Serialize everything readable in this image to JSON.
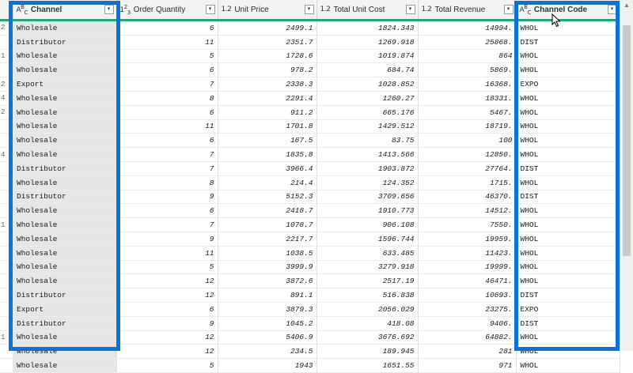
{
  "columns": [
    {
      "key": "channel",
      "type_icon": "A B C",
      "label": "Channel",
      "dropdown_icon": "dropdown-arrow-icon"
    },
    {
      "key": "order_quantity",
      "type_icon": "1 2 3",
      "label": "Order Quantity",
      "dropdown_icon": "dropdown-arrow-icon"
    },
    {
      "key": "unit_price",
      "type_icon": "1.2",
      "label": "Unit Price",
      "dropdown_icon": "dropdown-arrow-icon"
    },
    {
      "key": "total_unit_cost",
      "type_icon": "1.2",
      "label": "Total Unit Cost",
      "dropdown_icon": "dropdown-arrow-icon"
    },
    {
      "key": "total_revenue",
      "type_icon": "1.2",
      "label": "Total Revenue",
      "dropdown_icon": "dropdown-arrow-icon"
    },
    {
      "key": "channel_code",
      "type_icon": "A B C",
      "label": "Channel Code",
      "dropdown_icon": "dropdown-arrow-icon"
    }
  ],
  "rows": [
    {
      "rn": "2",
      "channel": "Wholesale",
      "qty": "6",
      "price": "2499.1",
      "cost": "1824.343",
      "rev": "14994.",
      "code": "WHOL"
    },
    {
      "rn": "",
      "channel": "Distributor",
      "qty": "11",
      "price": "2351.7",
      "cost": "1269.918",
      "rev": "25868.",
      "code": "DIST"
    },
    {
      "rn": "1",
      "channel": "Wholesale",
      "qty": "5",
      "price": "1728.6",
      "cost": "1019.874",
      "rev": "864",
      "code": "WHOL"
    },
    {
      "rn": "",
      "channel": "Wholesale",
      "qty": "6",
      "price": "978.2",
      "cost": "684.74",
      "rev": "5869.",
      "code": "WHOL"
    },
    {
      "rn": "2",
      "channel": "Export",
      "qty": "7",
      "price": "2338.3",
      "cost": "1028.852",
      "rev": "16368.",
      "code": "EXPO"
    },
    {
      "rn": "4",
      "channel": "Wholesale",
      "qty": "8",
      "price": "2291.4",
      "cost": "1260.27",
      "rev": "18331.",
      "code": "WHOL"
    },
    {
      "rn": "2",
      "channel": "Wholesale",
      "qty": "6",
      "price": "911.2",
      "cost": "665.176",
      "rev": "5467.",
      "code": "WHOL"
    },
    {
      "rn": "",
      "channel": "Wholesale",
      "qty": "11",
      "price": "1701.8",
      "cost": "1429.512",
      "rev": "18719.",
      "code": "WHOL"
    },
    {
      "rn": "",
      "channel": "Wholesale",
      "qty": "6",
      "price": "167.5",
      "cost": "83.75",
      "rev": "100",
      "code": "WHOL"
    },
    {
      "rn": "4",
      "channel": "Wholesale",
      "qty": "7",
      "price": "1835.8",
      "cost": "1413.566",
      "rev": "12850.",
      "code": "WHOL"
    },
    {
      "rn": "",
      "channel": "Distributor",
      "qty": "7",
      "price": "3966.4",
      "cost": "1903.872",
      "rev": "27764.",
      "code": "DIST"
    },
    {
      "rn": "",
      "channel": "Wholesale",
      "qty": "8",
      "price": "214.4",
      "cost": "124.352",
      "rev": "1715.",
      "code": "WHOL"
    },
    {
      "rn": "",
      "channel": "Distributor",
      "qty": "9",
      "price": "5152.3",
      "cost": "3709.656",
      "rev": "46370.",
      "code": "DIST"
    },
    {
      "rn": "",
      "channel": "Wholesale",
      "qty": "6",
      "price": "2418.7",
      "cost": "1910.773",
      "rev": "14512.",
      "code": "WHOL"
    },
    {
      "rn": "1",
      "channel": "Wholesale",
      "qty": "7",
      "price": "1078.7",
      "cost": "906.108",
      "rev": "7550.",
      "code": "WHOL"
    },
    {
      "rn": "",
      "channel": "Wholesale",
      "qty": "9",
      "price": "2217.7",
      "cost": "1596.744",
      "rev": "19959.",
      "code": "WHOL"
    },
    {
      "rn": "",
      "channel": "Wholesale",
      "qty": "11",
      "price": "1038.5",
      "cost": "633.485",
      "rev": "11423.",
      "code": "WHOL"
    },
    {
      "rn": "",
      "channel": "Wholesale",
      "qty": "5",
      "price": "3999.9",
      "cost": "3279.918",
      "rev": "19999.",
      "code": "WHOL"
    },
    {
      "rn": "",
      "channel": "Wholesale",
      "qty": "12",
      "price": "3872.6",
      "cost": "2517.19",
      "rev": "46471.",
      "code": "WHOL"
    },
    {
      "rn": "",
      "channel": "Distributor",
      "qty": "12",
      "price": "891.1",
      "cost": "516.838",
      "rev": "10693.",
      "code": "DIST"
    },
    {
      "rn": "",
      "channel": "Export",
      "qty": "6",
      "price": "3879.3",
      "cost": "2056.029",
      "rev": "23275.",
      "code": "EXPO"
    },
    {
      "rn": "",
      "channel": "Distributor",
      "qty": "9",
      "price": "1045.2",
      "cost": "418.08",
      "rev": "9406.",
      "code": "DIST"
    },
    {
      "rn": "1",
      "channel": "Wholesale",
      "qty": "12",
      "price": "5406.9",
      "cost": "3676.692",
      "rev": "64882.",
      "code": "WHOL"
    },
    {
      "rn": "",
      "channel": "Wholesale",
      "qty": "12",
      "price": "234.5",
      "cost": "189.945",
      "rev": "281",
      "code": "WHOL"
    },
    {
      "rn": "",
      "channel": "Wholesale",
      "qty": "5",
      "price": "1943",
      "cost": "1651.55",
      "rev": "971",
      "code": "WHOL"
    }
  ],
  "colors": {
    "highlight_box": "#0a73d9",
    "header_underline": "#21a87a",
    "selected_header": "#f7d98a",
    "selected_column": "#e6e6e6"
  },
  "icons": {
    "scroll_up": "scroll-up-arrow-icon",
    "cursor": "mouse-pointer-icon"
  }
}
